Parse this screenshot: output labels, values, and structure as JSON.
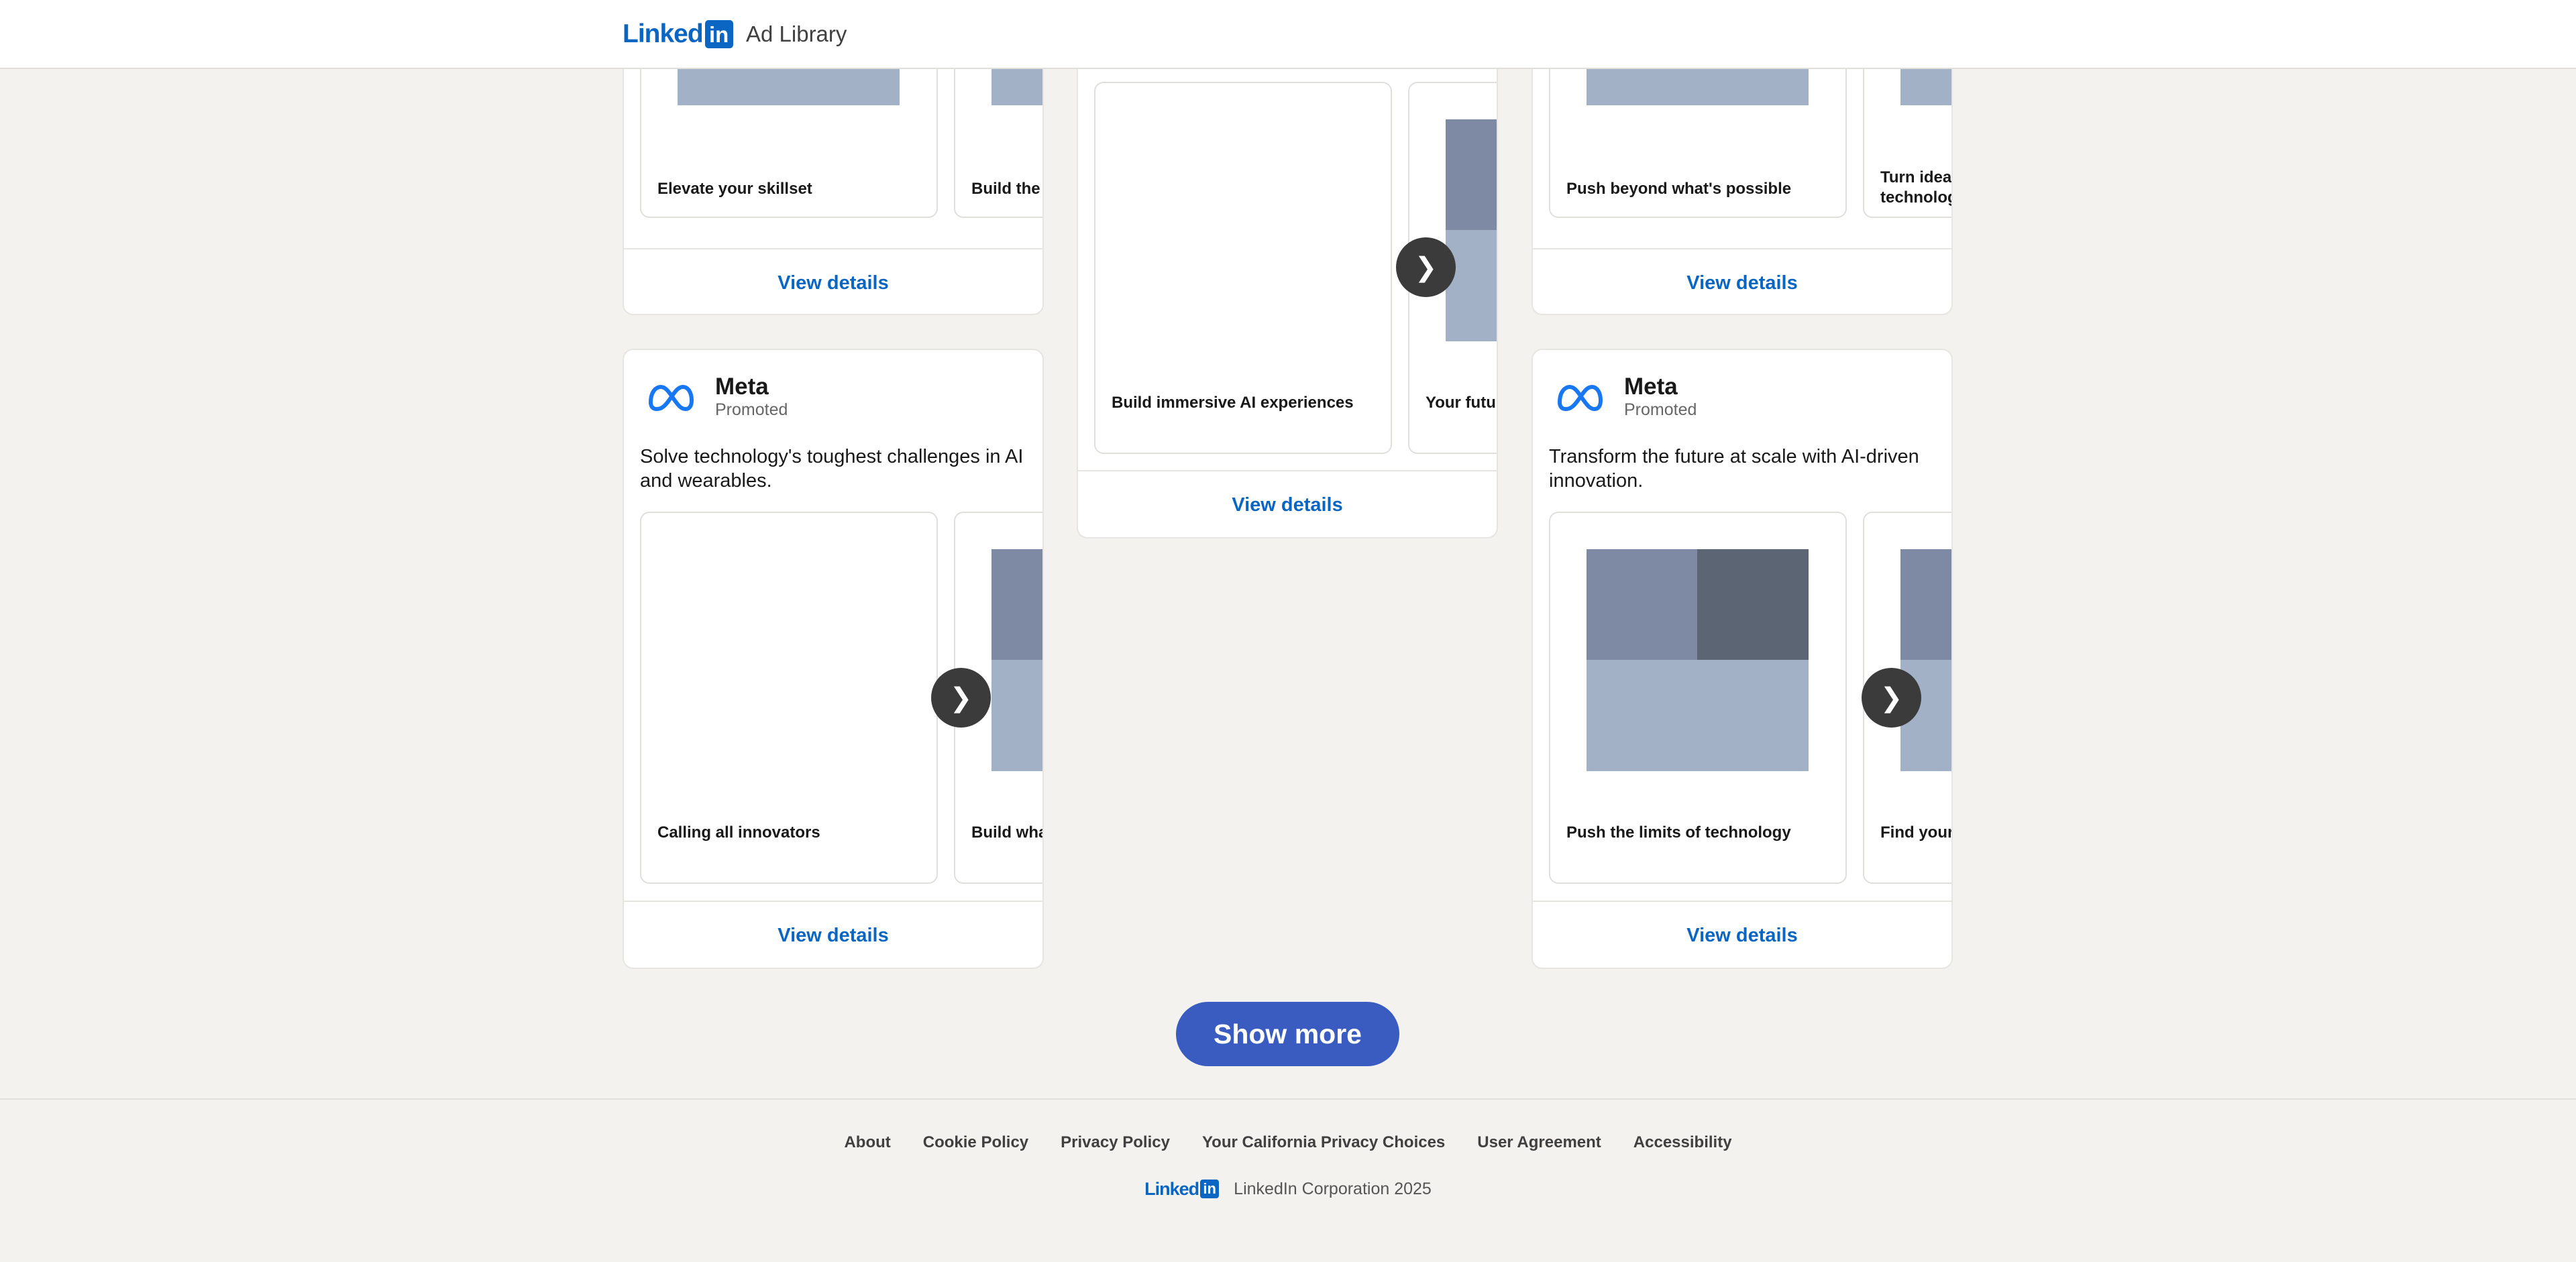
{
  "header": {
    "logo_linked": "Linked",
    "logo_in": "in",
    "title": "Ad Library"
  },
  "cards": [
    {
      "id": "top-left",
      "slides": [
        {
          "title": "Elevate your skillset"
        },
        {
          "title": "Build the"
        }
      ],
      "view_details": "View details"
    },
    {
      "id": "center",
      "slides": [
        {
          "title": "Build immersive AI experiences"
        },
        {
          "title": "Your futu"
        }
      ],
      "view_details": "View details"
    },
    {
      "id": "top-right",
      "slides": [
        {
          "title": "Push beyond what's possible"
        },
        {
          "title": "Turn idea\ntechnolog"
        }
      ],
      "view_details": "View details"
    },
    {
      "id": "bottom-left",
      "advertiser": "Meta",
      "promoted": "Promoted",
      "text": "Solve technology's toughest challenges in AI and wearables.",
      "slides": [
        {
          "title": "Calling all innovators"
        },
        {
          "title": "Build wha"
        }
      ],
      "view_details": "View details"
    },
    {
      "id": "bottom-right",
      "advertiser": "Meta",
      "promoted": "Promoted",
      "text": "Transform the future at scale with AI-driven innovation.",
      "slides": [
        {
          "title": "Push the limits of technology"
        },
        {
          "title": "Find your"
        }
      ],
      "view_details": "View details"
    }
  ],
  "next_glyph": "❯",
  "show_more": "Show more",
  "footer": {
    "links": [
      "About",
      "Cookie Policy",
      "Privacy Policy",
      "Your California Privacy Choices",
      "User Agreement",
      "Accessibility"
    ],
    "copyright": "LinkedIn Corporation 2025"
  },
  "colors": {
    "brand": "#0a66c2",
    "show_more_bg": "#3a5cc1",
    "page_bg": "#f3f2ee",
    "media_light": "#a3b1c7",
    "media_mid": "#7e8aa3",
    "media_dark": "#5b6574"
  },
  "icons": [
    "meta-logo-icon",
    "chevron-right-icon",
    "linkedin-logo-icon"
  ]
}
